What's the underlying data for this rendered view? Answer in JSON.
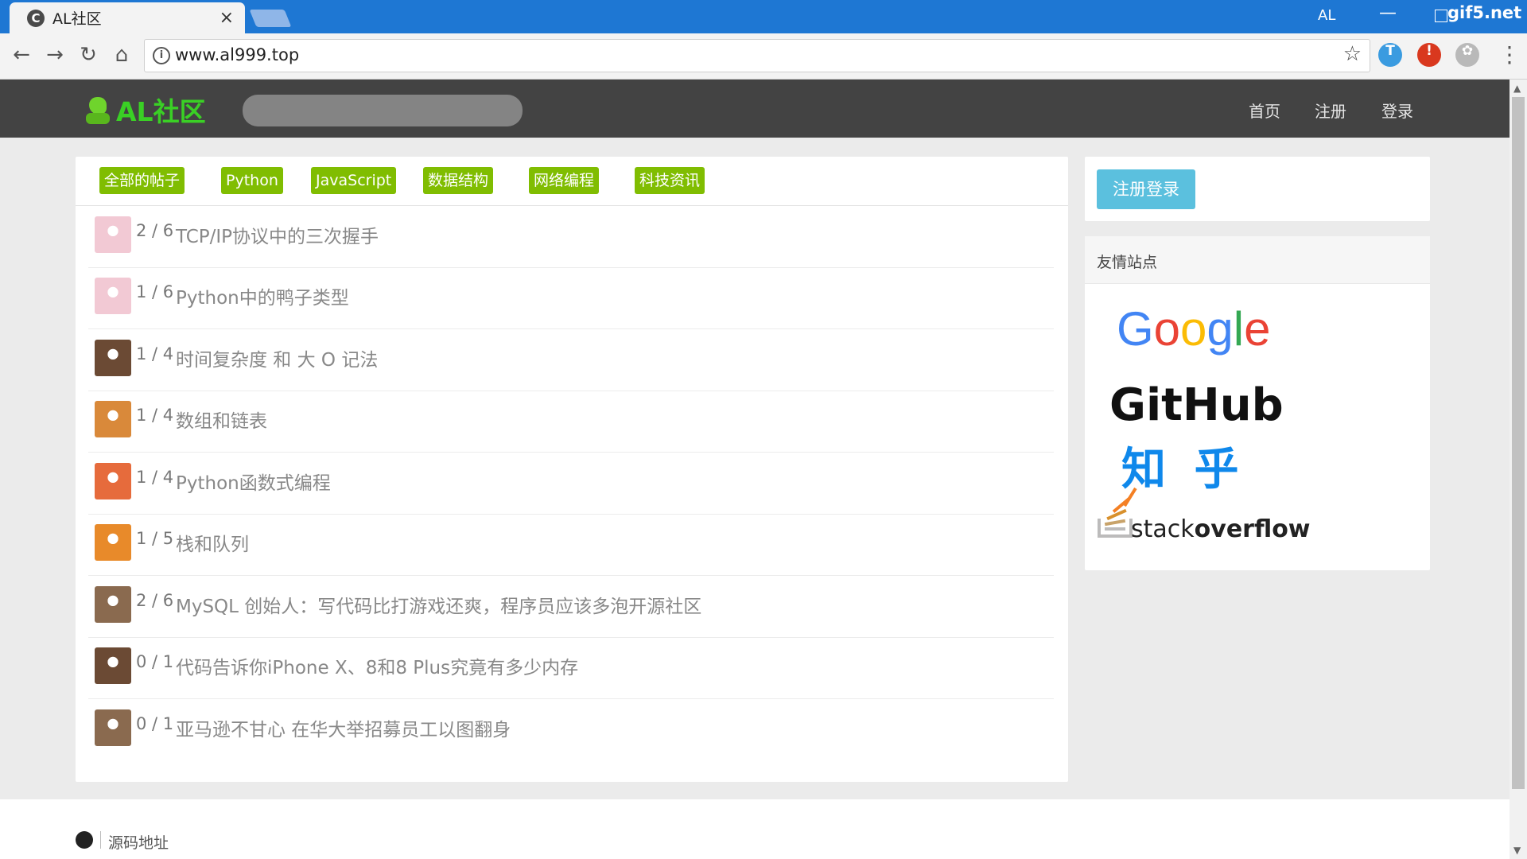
{
  "browser": {
    "tab_title": "AL社区",
    "tab_close": "×",
    "url": "www.al999.top",
    "window_user": "AL",
    "window_minimize": "—",
    "watermark": "gif5.net",
    "favicon_letter": "C",
    "icons": [
      "back-arrow-icon",
      "forward-arrow-icon",
      "reload-icon",
      "home-icon",
      "info-icon",
      "star-icon",
      "translate-extension-icon",
      "adblock-extension-icon",
      "paw-extension-icon",
      "menu-dots-icon"
    ],
    "nav_glyphs": {
      "back": "←",
      "forward": "→",
      "reload": "↻",
      "home": "⌂",
      "info": "i",
      "star": "☆",
      "menu": "⋮",
      "translate": "T",
      "adblock": "!",
      "paw": "✿"
    }
  },
  "header": {
    "logo_text": "AL社区",
    "search_placeholder": "",
    "nav": [
      {
        "label": "首页"
      },
      {
        "label": "注册"
      },
      {
        "label": "登录"
      }
    ]
  },
  "tags": [
    {
      "label": "全部的帖子"
    },
    {
      "label": "Python"
    },
    {
      "label": "JavaScript"
    },
    {
      "label": "数据结构"
    },
    {
      "label": "网络编程"
    },
    {
      "label": "科技资讯"
    }
  ],
  "topics": [
    {
      "count": "2 / 6",
      "title": "TCP/IP协议中的三次握手",
      "avatar_color": "#f2c9d4"
    },
    {
      "count": "1 / 6",
      "title": "Python中的鸭子类型",
      "avatar_color": "#f2c9d4"
    },
    {
      "count": "1 / 4",
      "title": "时间复杂度 和 大 O 记法",
      "avatar_color": "#6b4a34"
    },
    {
      "count": "1 / 4",
      "title": "数组和链表",
      "avatar_color": "#d9893a"
    },
    {
      "count": "1 / 4",
      "title": "Python函数式编程",
      "avatar_color": "#e66b3c"
    },
    {
      "count": "1 / 5",
      "title": "栈和队列",
      "avatar_color": "#e88a2a"
    },
    {
      "count": "2 / 6",
      "title": "MySQL 创始人：写代码比打游戏还爽，程序员应该多泡开源社区",
      "avatar_color": "#8a6a4f"
    },
    {
      "count": "0 / 1",
      "title": "代码告诉你iPhone X、8和8 Plus究竟有多少内存",
      "avatar_color": "#6b4a34"
    },
    {
      "count": "0 / 1",
      "title": "亚马逊不甘心 在华大举招募员工以图翻身",
      "avatar_color": "#8a6a4f"
    }
  ],
  "sidebar": {
    "login_button": "注册登录",
    "friends_title": "友情站点",
    "friends": {
      "google": "Google",
      "github": "GitHub",
      "zhihu": "知 乎",
      "stackoverflow_a": "stack",
      "stackoverflow_b": "overflow"
    }
  },
  "footer": {
    "source_link": "源码地址"
  },
  "colors": {
    "tab_bar": "#1e77d3",
    "header_bg": "#434343",
    "logo_green": "#3ad025",
    "tag_green": "#80bd01",
    "login_blue": "#5bc0de",
    "zhihu_blue": "#0f88eb"
  }
}
